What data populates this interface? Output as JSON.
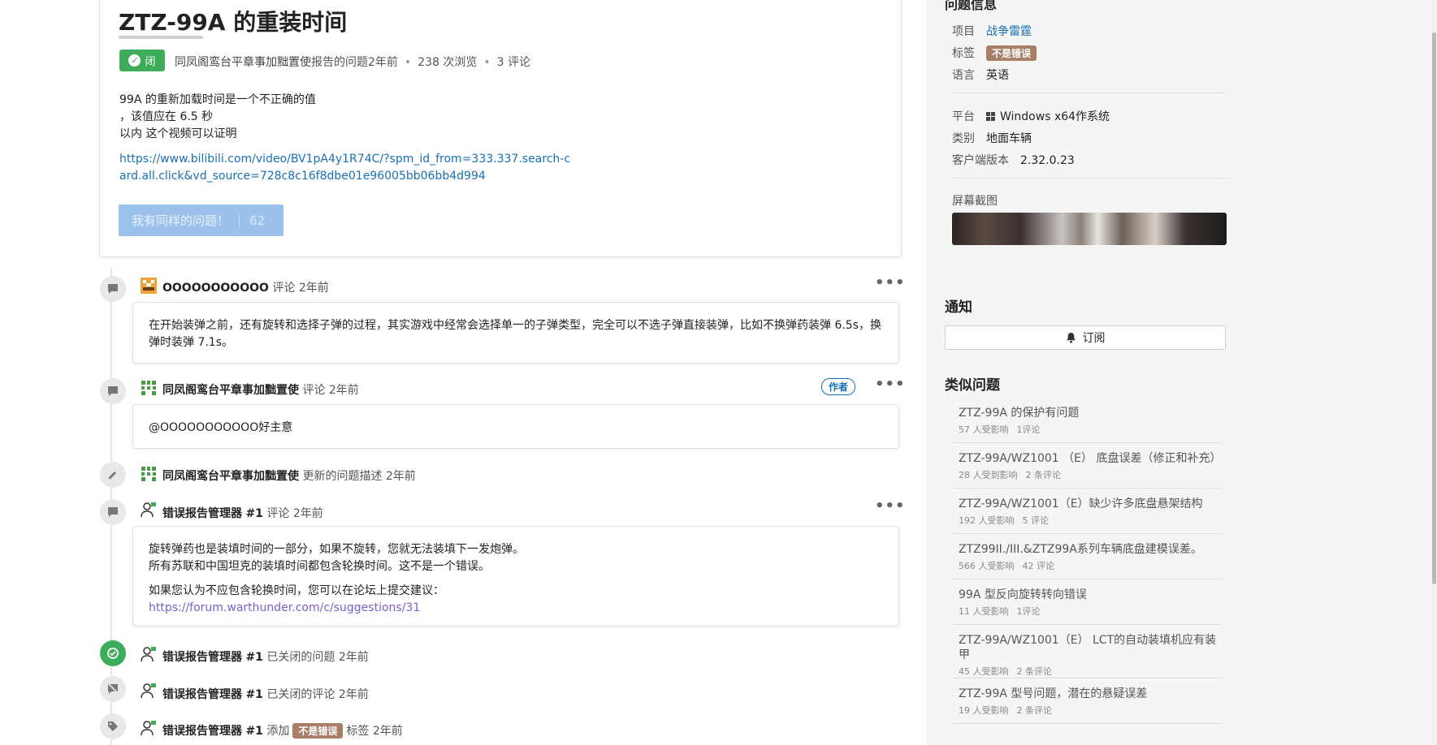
{
  "issue": {
    "title": "ZTZ-99A 的重装时间",
    "status": "闭",
    "author": "同凤阁鸾台平章事加黜置使",
    "reported": "报告的问题2年前",
    "views": "238 次浏览",
    "comments": "3 评论",
    "body_lines": [
      "99A 的重新加载时间是一个不正确的值",
      "，该值应在 6.5 秒",
      "以内 这个视频可以证明"
    ],
    "link": "https://www.bilibili.com/video/BV1pA4y1R74C/?spm_id_from=333.337.search-card.all.click&vd_source=728c8c16f8dbe01e96005bb06bb4d994",
    "same_label": "我有同样的问题！",
    "same_count": "62"
  },
  "timeline": {
    "c1": {
      "user": "OOOOOOOOOOO",
      "action": "评论 2年前",
      "text": "在开始装弹之前，还有旋转和选择子弹的过程，其实游戏中经常会选择单一的子弹类型，完全可以不选子弹直接装弹，比如不换弹药装弹 6.5s，换弹时装弹 7.1s。"
    },
    "c2": {
      "user": "同凤阁鸾台平章事加黜置使",
      "action": "评论 2年前",
      "badge": "作者",
      "text": "@OOOOOOOOOOO好主意"
    },
    "e1": {
      "user": "同凤阁鸾台平章事加黜置使",
      "action": "更新的问题描述 2年前"
    },
    "c3": {
      "user": "错误报告管理器",
      "num": "#1",
      "action": "评论 2年前",
      "line1": "旋转弹药也是装填时间的一部分，如果不旋转，您就无法装填下一发炮弹。",
      "line2": "所有苏联和中国坦克的装填时间都包含轮换时间。这不是一个错误。",
      "line3": "如果您认为不应包含轮换时间，您可以在论坛上提交建议：",
      "link": "https://forum.warthunder.com/c/suggestions/31"
    },
    "e2": {
      "user": "错误报告管理器",
      "num": "#1",
      "action": "已关闭的问题 2年前"
    },
    "e3": {
      "user": "错误报告管理器",
      "num": "#1",
      "action": "已关闭的评论 2年前"
    },
    "e4": {
      "user": "错误报告管理器",
      "num": "#1",
      "pre": "添加",
      "tag": "不是错误",
      "post": "标签 2年前"
    }
  },
  "sidebar": {
    "info_title": "问题信息",
    "project_label": "项目",
    "project": "战争雷霆",
    "tag_label": "标签",
    "tag": "不是错误",
    "lang_label": "语言",
    "lang": "英语",
    "platform_label": "平台",
    "platform": "Windows x64作系统",
    "category_label": "类别",
    "category": "地面车辆",
    "client_label": "客户端版本",
    "client": "2.32.0.23",
    "screenshot_label": "屏幕截图",
    "notify_title": "通知",
    "subscribe": "订阅",
    "similar_title": "类似问题",
    "similar": [
      {
        "title": "ZTZ-99A 的保护有问题",
        "affected": "57 人受影响",
        "comments": "1评论"
      },
      {
        "title": "ZTZ-99A/WZ1001 （E） 底盘误差（修正和补充）",
        "affected": "28 人受到影响",
        "comments": "2 条评论"
      },
      {
        "title": "ZTZ-99A/WZ1001（E）缺少许多底盘悬架结构",
        "affected": "192 人受影响",
        "comments": "5 评论"
      },
      {
        "title": "ZTZ99II./III.&ZTZ99A系列车辆底盘建模误差。",
        "affected": "566 人受影响",
        "comments": "42 评论"
      },
      {
        "title": "99A 型反向旋转转向错误",
        "affected": "11 人受影响",
        "comments": "1评论"
      },
      {
        "title": "ZTZ-99A/WZ1001（E） LCT的自动装填机应有装甲",
        "affected": "45 人受影响",
        "comments": "2 条评论"
      },
      {
        "title": "ZTZ-99A 型号问题，潜在的悬疑误差",
        "affected": "19 人受影响",
        "comments": "2 条评论"
      }
    ]
  }
}
